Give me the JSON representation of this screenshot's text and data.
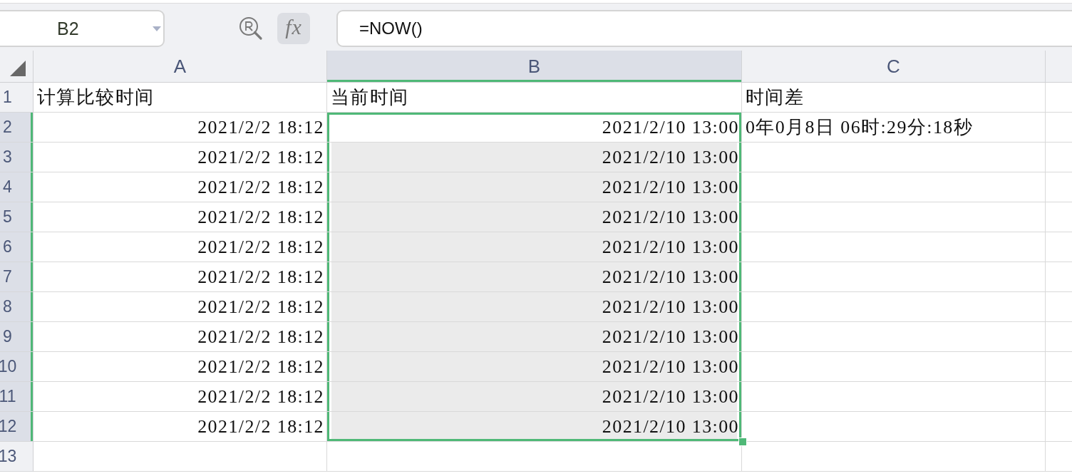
{
  "formula_toolbar": {
    "name_box": {
      "value": "B2"
    },
    "function_button": {
      "label": "fx"
    },
    "formula": {
      "value": "=NOW()"
    }
  },
  "column_headers": [
    {
      "label": "A",
      "selected": false
    },
    {
      "label": "B",
      "selected": true
    },
    {
      "label": "C",
      "selected": false
    }
  ],
  "rows": [
    {
      "number": "1",
      "selected": false,
      "cells": [
        {
          "text": "计算比较时间",
          "kind": "text",
          "selected": false,
          "active": false
        },
        {
          "text": "当前时间",
          "kind": "text",
          "selected": false,
          "active": false
        },
        {
          "text": "时间差",
          "kind": "text",
          "selected": false,
          "active": false
        }
      ]
    },
    {
      "number": "2",
      "selected": true,
      "cells": [
        {
          "text": "2021/2/2 18:12",
          "kind": "number",
          "selected": false,
          "active": false
        },
        {
          "text": "2021/2/10 13:00",
          "kind": "number",
          "selected": true,
          "active": true
        },
        {
          "text": "0年0月8日 06时:29分:18秒",
          "kind": "text",
          "selected": false,
          "active": false
        }
      ]
    },
    {
      "number": "3",
      "selected": true,
      "cells": [
        {
          "text": "2021/2/2 18:12",
          "kind": "number",
          "selected": false,
          "active": false
        },
        {
          "text": "2021/2/10 13:00",
          "kind": "number",
          "selected": true,
          "active": false
        },
        {
          "selected": false,
          "active": false
        }
      ]
    },
    {
      "number": "4",
      "selected": true,
      "cells": [
        {
          "text": "2021/2/2 18:12",
          "kind": "number",
          "selected": false,
          "active": false
        },
        {
          "text": "2021/2/10 13:00",
          "kind": "number",
          "selected": true,
          "active": false
        },
        {
          "selected": false,
          "active": false
        }
      ]
    },
    {
      "number": "5",
      "selected": true,
      "cells": [
        {
          "text": "2021/2/2 18:12",
          "kind": "number",
          "selected": false,
          "active": false
        },
        {
          "text": "2021/2/10 13:00",
          "kind": "number",
          "selected": true,
          "active": false
        },
        {
          "selected": false,
          "active": false
        }
      ]
    },
    {
      "number": "6",
      "selected": true,
      "cells": [
        {
          "text": "2021/2/2 18:12",
          "kind": "number",
          "selected": false,
          "active": false
        },
        {
          "text": "2021/2/10 13:00",
          "kind": "number",
          "selected": true,
          "active": false
        },
        {
          "selected": false,
          "active": false
        }
      ]
    },
    {
      "number": "7",
      "selected": true,
      "cells": [
        {
          "text": "2021/2/2 18:12",
          "kind": "number",
          "selected": false,
          "active": false
        },
        {
          "text": "2021/2/10 13:00",
          "kind": "number",
          "selected": true,
          "active": false
        },
        {
          "selected": false,
          "active": false
        }
      ]
    },
    {
      "number": "8",
      "selected": true,
      "cells": [
        {
          "text": "2021/2/2 18:12",
          "kind": "number",
          "selected": false,
          "active": false
        },
        {
          "text": "2021/2/10 13:00",
          "kind": "number",
          "selected": true,
          "active": false
        },
        {
          "selected": false,
          "active": false
        }
      ]
    },
    {
      "number": "9",
      "selected": true,
      "cells": [
        {
          "text": "2021/2/2 18:12",
          "kind": "number",
          "selected": false,
          "active": false
        },
        {
          "text": "2021/2/10 13:00",
          "kind": "number",
          "selected": true,
          "active": false
        },
        {
          "selected": false,
          "active": false
        }
      ]
    },
    {
      "number": "10",
      "selected": true,
      "cells": [
        {
          "text": "2021/2/2 18:12",
          "kind": "number",
          "selected": false,
          "active": false
        },
        {
          "text": "2021/2/10 13:00",
          "kind": "number",
          "selected": true,
          "active": false
        },
        {
          "selected": false,
          "active": false
        }
      ]
    },
    {
      "number": "11",
      "selected": true,
      "cells": [
        {
          "text": "2021/2/2 18:12",
          "kind": "number",
          "selected": false,
          "active": false
        },
        {
          "text": "2021/2/10 13:00",
          "kind": "number",
          "selected": true,
          "active": false
        },
        {
          "selected": false,
          "active": false
        }
      ]
    },
    {
      "number": "12",
      "selected": true,
      "cells": [
        {
          "text": "2021/2/2 18:12",
          "kind": "number",
          "selected": false,
          "active": false
        },
        {
          "text": "2021/2/10 13:00",
          "kind": "number",
          "selected": true,
          "active": false
        },
        {
          "selected": false,
          "active": false
        }
      ]
    },
    {
      "number": "13",
      "selected": false,
      "cells": [
        {
          "selected": false,
          "active": false
        },
        {
          "selected": false,
          "active": false
        },
        {
          "selected": false,
          "active": false
        }
      ]
    }
  ]
}
